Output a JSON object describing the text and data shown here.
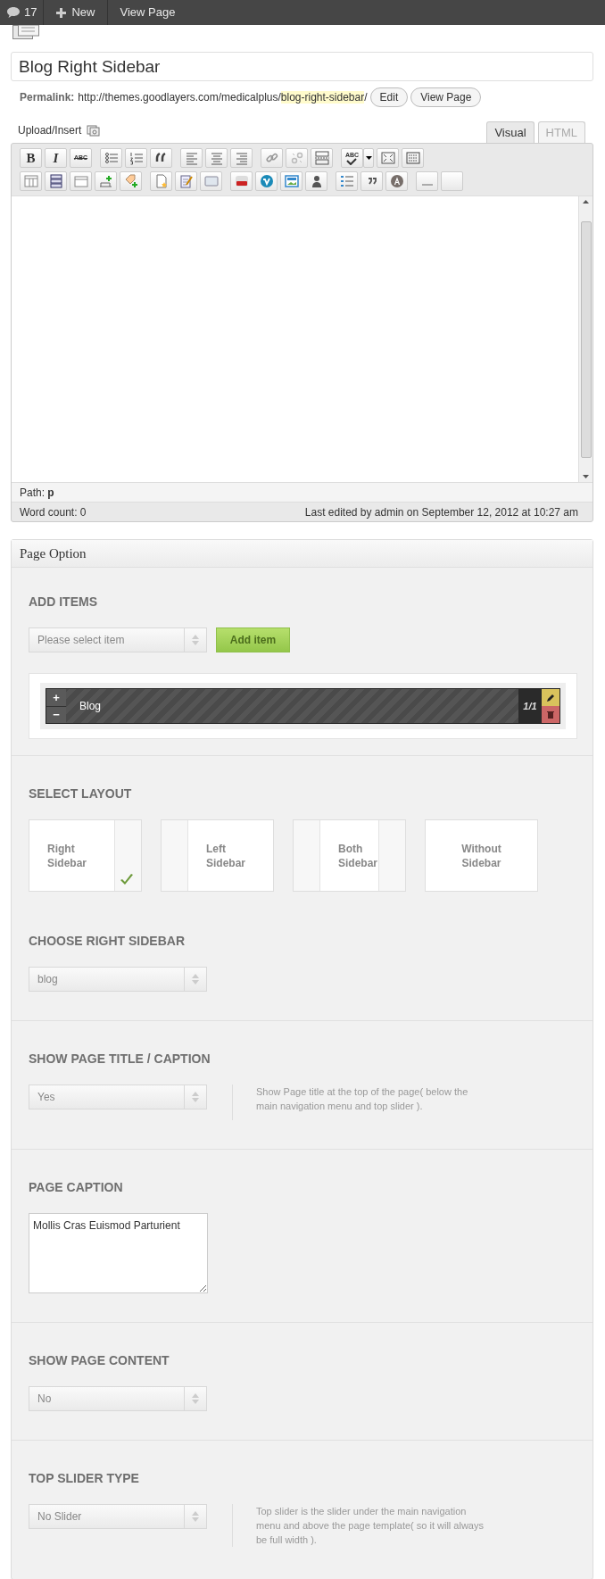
{
  "admin_bar": {
    "comments_count": "17",
    "new_label": "New",
    "view_page_label": "View Page"
  },
  "title_field": {
    "value": "Blog Right Sidebar"
  },
  "permalink": {
    "label": "Permalink:",
    "base": "http://themes.goodlayers.com/medicalplus/",
    "slug": "blog-right-sidebar",
    "trailing": "/",
    "edit_button": "Edit",
    "view_button": "View Page"
  },
  "editor": {
    "upload_label": "Upload/Insert",
    "tabs": [
      {
        "label": "Visual",
        "selected": true
      },
      {
        "label": "HTML",
        "selected": false
      }
    ],
    "toolbar": {
      "bold": "B",
      "italic": "I",
      "strikethrough": "ABC",
      "spellcheck": "ABC"
    },
    "path_label": "Path:",
    "path_value": "p",
    "word_count": "Word count: 0",
    "last_edited": "Last edited by admin on September 12, 2012 at 10:27 am"
  },
  "page_option": {
    "title": "Page Option",
    "add_items": {
      "heading": "ADD ITEMS",
      "select": "Please select item",
      "button": "Add item",
      "items": [
        {
          "plus": "+",
          "minus": "−",
          "label": "Blog",
          "count": "1/1"
        }
      ]
    },
    "select_layout": {
      "heading": "SELECT LAYOUT",
      "options": [
        {
          "kind": "right",
          "lines": [
            "Right",
            "Sidebar"
          ],
          "selected": true
        },
        {
          "kind": "left",
          "lines": [
            "Left",
            "Sidebar"
          ],
          "selected": false
        },
        {
          "kind": "both",
          "lines": [
            "Both",
            "Sidebar"
          ],
          "selected": false
        },
        {
          "kind": "none",
          "lines": [
            "Without",
            "Sidebar"
          ],
          "selected": false
        }
      ]
    },
    "sections": [
      {
        "kind": "select",
        "heading": "CHOOSE RIGHT SIDEBAR",
        "value": "blog"
      },
      {
        "kind": "select",
        "heading": "SHOW PAGE TITLE / CAPTION",
        "value": "Yes",
        "hint": "Show Page title at the top of the page( below the main navigation menu and top slider )."
      },
      {
        "kind": "textarea",
        "heading": "PAGE CAPTION",
        "value": "Mollis Cras Euismod Parturient"
      },
      {
        "kind": "select",
        "heading": "SHOW PAGE CONTENT",
        "value": "No"
      },
      {
        "kind": "select",
        "heading": "TOP SLIDER TYPE",
        "value": "No Slider",
        "hint": "Top slider is the slider under the main navigation menu and above the page template( so it will always be full width )."
      }
    ]
  }
}
